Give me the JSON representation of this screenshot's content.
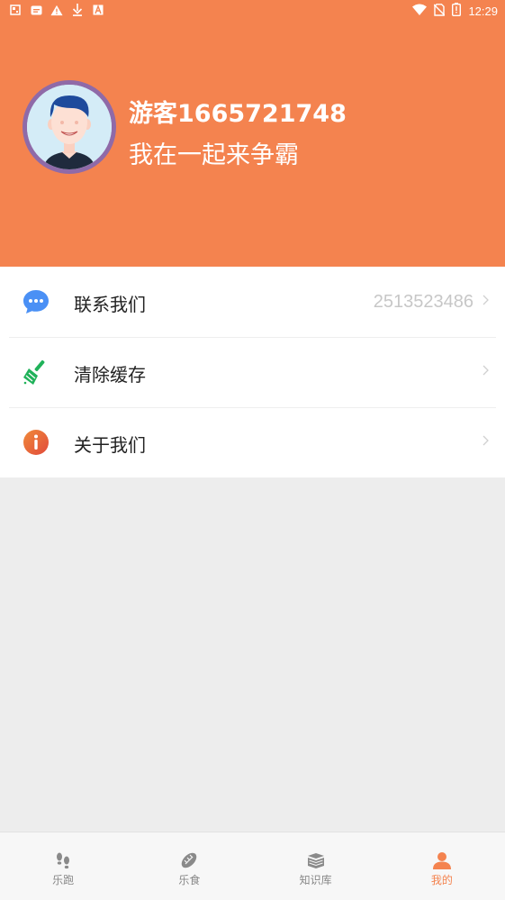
{
  "status_bar": {
    "time": "12:29",
    "left_icons": [
      "sim-icon",
      "message-icon",
      "warning-icon",
      "download-icon",
      "app-icon"
    ],
    "right_icons": [
      "wifi-icon",
      "no-sim-icon",
      "battery-icon"
    ]
  },
  "profile": {
    "username": "游客1665721748",
    "slogan": "我在一起来争霸",
    "avatar_icon": "avatar-icon"
  },
  "menu": {
    "items": [
      {
        "label": "联系我们",
        "value": "2513523486",
        "icon": "chat-icon"
      },
      {
        "label": "清除缓存",
        "value": "",
        "icon": "broom-icon"
      },
      {
        "label": "关于我们",
        "value": "",
        "icon": "info-icon"
      }
    ]
  },
  "tabbar": {
    "tabs": [
      {
        "label": "乐跑",
        "icon": "footprints-icon"
      },
      {
        "label": "乐食",
        "icon": "food-icon"
      },
      {
        "label": "知识库",
        "icon": "books-icon"
      },
      {
        "label": "我的",
        "icon": "person-icon",
        "active": true
      }
    ]
  },
  "colors": {
    "brand": "#f4834f",
    "avatar_ring": "#8f6aa8",
    "chat": "#4a90f5",
    "broom": "#20b25a",
    "info": "#e85f3a"
  }
}
